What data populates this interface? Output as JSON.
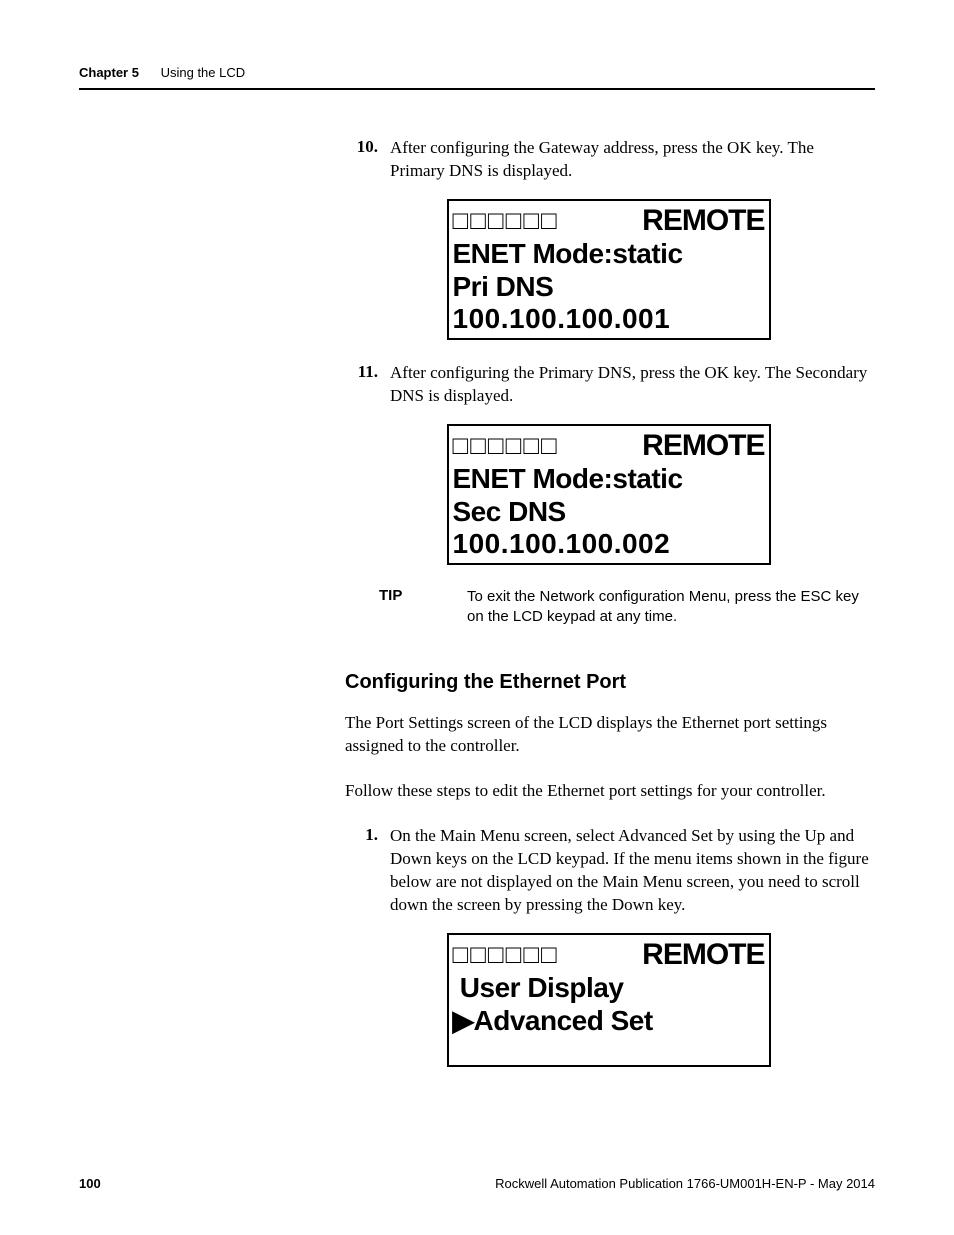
{
  "header": {
    "chapter": "Chapter 5",
    "title": "Using the LCD"
  },
  "steps": {
    "s10": {
      "num": "10.",
      "text": "After configuring the Gateway address, press the OK key. The Primary DNS is displayed."
    },
    "s11": {
      "num": "11.",
      "text": "After configuring the Primary DNS, press the OK key. The Secondary DNS is displayed."
    },
    "s1": {
      "num": "1.",
      "text": "On the Main Menu screen, select Advanced Set by using the Up and Down keys on the LCD keypad. If the menu items shown in the figure below are not displayed on the Main Menu screen, you need to scroll down the screen by pressing the Down key."
    }
  },
  "lcd1": {
    "boxes": "□□□□□□",
    "remote": "REMOTE",
    "line2": "ENET Mode:static",
    "line3": "Pri DNS",
    "line4": "100.100.100.001"
  },
  "lcd2": {
    "boxes": "□□□□□□",
    "remote": "REMOTE",
    "line2": "ENET Mode:static",
    "line3": "Sec DNS",
    "line4": "100.100.100.002"
  },
  "lcd3": {
    "boxes": "□□□□□□",
    "remote": "REMOTE",
    "line2": " User Display",
    "line3": "▶Advanced Set"
  },
  "tip": {
    "label": "TIP",
    "text": "To exit the Network configuration Menu, press the ESC key on the LCD keypad at any time."
  },
  "section": {
    "heading": "Configuring the Ethernet Port",
    "p1": "The Port Settings screen of the LCD displays the Ethernet port settings assigned to the controller.",
    "p2": "Follow these steps to edit the Ethernet port settings for your controller."
  },
  "footer": {
    "page": "100",
    "pub": "Rockwell Automation Publication 1766-UM001H-EN-P - May 2014"
  }
}
